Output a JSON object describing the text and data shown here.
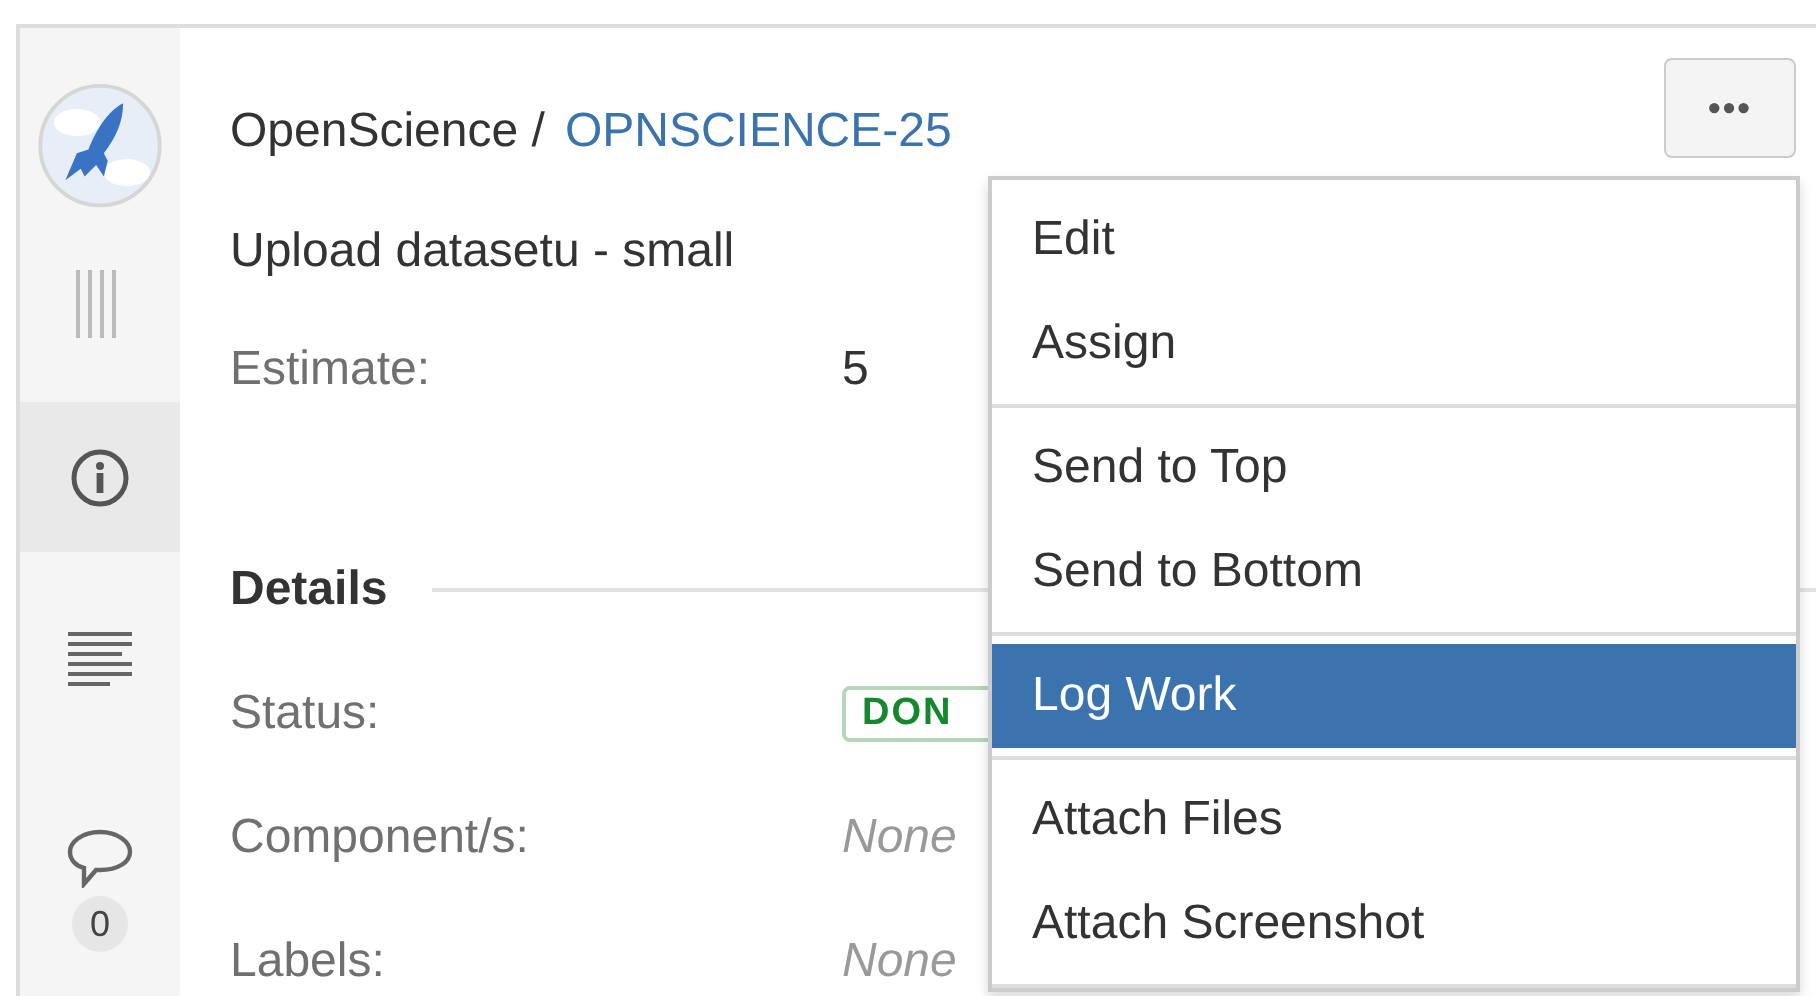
{
  "sidebar": {
    "items": [
      {
        "kind": "handle",
        "selected": false
      },
      {
        "kind": "info",
        "selected": true
      },
      {
        "kind": "description",
        "selected": false
      },
      {
        "kind": "comments",
        "selected": false,
        "count": "0"
      }
    ]
  },
  "header": {
    "project": "OpenScience /",
    "issue_key": "OPNSCIENCE-25",
    "more_button": "•••"
  },
  "summary": "Upload datasetu - small",
  "estimate": {
    "label": "Estimate:",
    "value": "5"
  },
  "details": {
    "heading": "Details",
    "fields": [
      {
        "label": "Status:",
        "kind": "lozenge",
        "value": "DON"
      },
      {
        "label": "Component/s:",
        "kind": "none",
        "value": "None"
      },
      {
        "label": "Labels:",
        "kind": "none",
        "value": "None"
      }
    ]
  },
  "menu": {
    "groups": [
      [
        {
          "label": "Edit",
          "selected": false
        },
        {
          "label": "Assign",
          "selected": false
        }
      ],
      [
        {
          "label": "Send to Top",
          "selected": false
        },
        {
          "label": "Send to Bottom",
          "selected": false
        }
      ],
      [
        {
          "label": "Log Work",
          "selected": true
        }
      ],
      [
        {
          "label": "Attach Files",
          "selected": false
        },
        {
          "label": "Attach Screenshot",
          "selected": false
        }
      ]
    ]
  }
}
